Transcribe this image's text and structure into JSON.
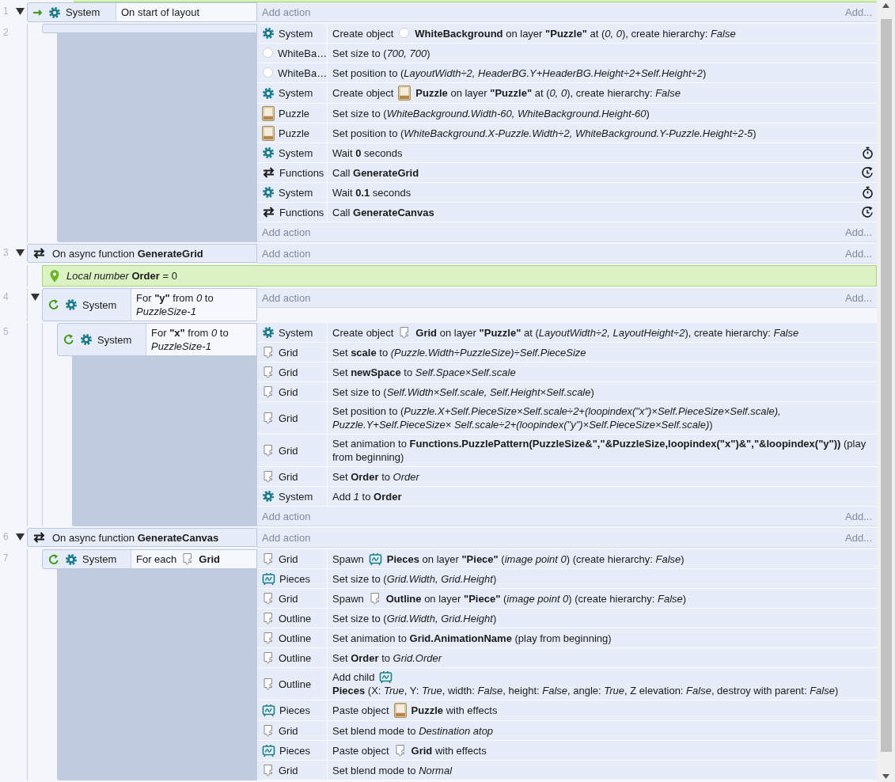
{
  "events": [
    {
      "kind": "trigger",
      "number": "1",
      "expanded": true,
      "object": {
        "kind": "system",
        "name": "System"
      },
      "parts": [
        {
          "kind": "text",
          "text": "On start of layout"
        }
      ],
      "add_action": "Add action",
      "add": "Add...",
      "children": [
        {
          "kind": "block",
          "number": "2",
          "add_action": "Add action",
          "add": "Add...",
          "actions": [
            {
              "object": {
                "kind": "system",
                "name": "System"
              },
              "parts": [
                {
                  "kind": "text",
                  "text": "Create object"
                },
                {
                  "kind": "round-sprite"
                },
                {
                  "kind": "text",
                  "text": "**WhiteBackground** on layer **\"Puzzle\"** at (*0, 0*), create hierarchy: *False*"
                }
              ]
            },
            {
              "object": {
                "kind": "round-sprite",
                "name": "WhiteBa…"
              },
              "parts": [
                {
                  "kind": "text",
                  "text": "Set size to (*700, 700*)"
                }
              ]
            },
            {
              "object": {
                "kind": "round-sprite",
                "name": "WhiteBa…"
              },
              "parts": [
                {
                  "kind": "text",
                  "text": "Set position to (*LayoutWidth÷2, HeaderBG.Y+HeaderBG.Height÷2+Self.Height÷2*)"
                }
              ]
            },
            {
              "object": {
                "kind": "system",
                "name": "System"
              },
              "parts": [
                {
                  "kind": "text",
                  "text": "Create object"
                },
                {
                  "kind": "image-sprite"
                },
                {
                  "kind": "text",
                  "text": "**Puzzle** on layer **\"Puzzle\"** at (*0, 0*), create hierarchy: *False*"
                }
              ]
            },
            {
              "object": {
                "kind": "image-sprite",
                "name": "Puzzle"
              },
              "parts": [
                {
                  "kind": "text",
                  "text": "Set size to (*WhiteBackground.Width-60, WhiteBackground.Height-60*)"
                }
              ]
            },
            {
              "object": {
                "kind": "image-sprite",
                "name": "Puzzle"
              },
              "parts": [
                {
                  "kind": "text",
                  "text": "Set position to (*WhiteBackground.X-Puzzle.Width÷2, WhiteBackground.Y-Puzzle.Height÷2-5*)"
                }
              ]
            },
            {
              "object": {
                "kind": "system",
                "name": "System"
              },
              "parts": [
                {
                  "kind": "text",
                  "text": "Wait **0** seconds"
                }
              ],
              "suffix": {
                "kind": "wait"
              }
            },
            {
              "object": {
                "kind": "function",
                "name": "Functions"
              },
              "parts": [
                {
                  "kind": "text",
                  "text": "Call **GenerateGrid**"
                }
              ],
              "suffix": {
                "kind": "await"
              }
            },
            {
              "object": {
                "kind": "system",
                "name": "System"
              },
              "parts": [
                {
                  "kind": "text",
                  "text": "Wait **0.1** seconds"
                }
              ],
              "suffix": {
                "kind": "wait"
              }
            },
            {
              "object": {
                "kind": "function",
                "name": "Functions"
              },
              "parts": [
                {
                  "kind": "text",
                  "text": "Call **GenerateCanvas**"
                }
              ],
              "suffix": {
                "kind": "await"
              }
            }
          ]
        }
      ]
    },
    {
      "kind": "function",
      "number": "3",
      "expanded": true,
      "parts": [
        {
          "kind": "text",
          "text": "On async function **GenerateGrid**"
        }
      ],
      "add_action": "Add action",
      "add": "Add...",
      "children": [
        {
          "kind": "variable",
          "text": "*Local number* **Order** = 0"
        },
        {
          "kind": "loop",
          "number": "4",
          "expanded": true,
          "object": {
            "kind": "system",
            "name": "System"
          },
          "parts": [
            {
              "kind": "text",
              "text": "For **\"y\"** from *0* to *PuzzleSize-1*"
            }
          ],
          "add_action": "Add action",
          "add": "Add...",
          "children": [
            {
              "kind": "loop",
              "number": "5",
              "object": {
                "kind": "system",
                "name": "System"
              },
              "parts": [
                {
                  "kind": "text",
                  "text": "For **\"x\"** from *0* to *PuzzleSize-1*"
                }
              ],
              "add_action": "Add action",
              "add": "Add...",
              "actions": [
                {
                  "object": {
                    "kind": "system",
                    "name": "System"
                  },
                  "parts": [
                    {
                      "kind": "text",
                      "text": "Create object"
                    },
                    {
                      "kind": "outline-sprite"
                    },
                    {
                      "kind": "text",
                      "text": "**Grid** on layer **\"Puzzle\"** at (*LayoutWidth÷2, LayoutHeight÷2*), create hierarchy: *False*"
                    }
                  ]
                },
                {
                  "object": {
                    "kind": "outline-sprite",
                    "name": "Grid"
                  },
                  "parts": [
                    {
                      "kind": "text",
                      "text": "Set **scale** to *(Puzzle.Width÷PuzzleSize)÷Self.PieceSize*"
                    }
                  ]
                },
                {
                  "object": {
                    "kind": "outline-sprite",
                    "name": "Grid"
                  },
                  "parts": [
                    {
                      "kind": "text",
                      "text": "Set **newSpace** to *Self.Space×Self.scale*"
                    }
                  ]
                },
                {
                  "object": {
                    "kind": "outline-sprite",
                    "name": "Grid"
                  },
                  "parts": [
                    {
                      "kind": "text",
                      "text": "Set size to (*Self.Width×Self.scale, Self.Height×Self.scale*)"
                    }
                  ]
                },
                {
                  "object": {
                    "kind": "outline-sprite",
                    "name": "Grid"
                  },
                  "parts": [
                    {
                      "kind": "text",
                      "text": "Set position to (*Puzzle.X+Self.PieceSize×Self.scale÷2+(loopindex(\"x\")×Self.PieceSize×Self.scale), Puzzle.Y+Self.PieceSize× Self.scale÷2+(loopindex(\"y\")×Self.PieceSize×Self.scale)*)"
                    }
                  ]
                },
                {
                  "object": {
                    "kind": "outline-sprite",
                    "name": "Grid"
                  },
                  "parts": [
                    {
                      "kind": "text",
                      "text": "Set animation to **Functions.PuzzlePattern(PuzzleSize&\",\"&PuzzleSize,loopindex(\"x\")&\",\"&loopindex(\"y\"))** (play from beginning)"
                    }
                  ]
                },
                {
                  "object": {
                    "kind": "outline-sprite",
                    "name": "Grid"
                  },
                  "parts": [
                    {
                      "kind": "text",
                      "text": "Set **Order** to *Order*"
                    }
                  ]
                },
                {
                  "object": {
                    "kind": "system",
                    "name": "System"
                  },
                  "parts": [
                    {
                      "kind": "text",
                      "text": "Add *1* to **Order**"
                    }
                  ]
                }
              ]
            }
          ]
        }
      ]
    },
    {
      "kind": "function",
      "number": "6",
      "expanded": true,
      "parts": [
        {
          "kind": "text",
          "text": "On async function **GenerateCanvas**"
        }
      ],
      "add_action": "Add action",
      "add": "Add...",
      "children": [
        {
          "kind": "loop",
          "number": "7",
          "object": {
            "kind": "system",
            "name": "System"
          },
          "parts": [
            {
              "kind": "text",
              "text": "For each"
            },
            {
              "kind": "outline-sprite"
            },
            {
              "kind": "text",
              "text": "**Grid**"
            }
          ],
          "actions": [
            {
              "object": {
                "kind": "outline-sprite",
                "name": "Grid"
              },
              "parts": [
                {
                  "kind": "text",
                  "text": "Spawn"
                },
                {
                  "kind": "drawing-canvas"
                },
                {
                  "kind": "text",
                  "text": "**Pieces** on layer **\"Piece\"** (*image point 0*) (create hierarchy: *False*)"
                }
              ]
            },
            {
              "object": {
                "kind": "drawing-canvas",
                "name": "Pieces"
              },
              "parts": [
                {
                  "kind": "text",
                  "text": "Set size to (*Grid.Width, Grid.Height*)"
                }
              ]
            },
            {
              "object": {
                "kind": "outline-sprite",
                "name": "Grid"
              },
              "parts": [
                {
                  "kind": "text",
                  "text": "Spawn"
                },
                {
                  "kind": "outline-sprite"
                },
                {
                  "kind": "text",
                  "text": "**Outline** on layer **\"Piece\"** (*image point 0*) (create hierarchy: *False*)"
                }
              ]
            },
            {
              "object": {
                "kind": "outline-sprite",
                "name": "Outline"
              },
              "parts": [
                {
                  "kind": "text",
                  "text": "Set size to (*Grid.Width, Grid.Height*)"
                }
              ]
            },
            {
              "object": {
                "kind": "outline-sprite",
                "name": "Outline"
              },
              "parts": [
                {
                  "kind": "text",
                  "text": "Set animation to **Grid.AnimationName** (play from beginning)"
                }
              ]
            },
            {
              "object": {
                "kind": "outline-sprite",
                "name": "Outline"
              },
              "parts": [
                {
                  "kind": "text",
                  "text": "Set **Order** to *Grid.Order*"
                }
              ]
            },
            {
              "object": {
                "kind": "outline-sprite",
                "name": "Outline"
              },
              "parts": [
                {
                  "kind": "text",
                  "text": "Add child"
                },
                {
                  "kind": "drawing-canvas"
                },
                {
                  "kind": "text",
                  "text": "**Pieces** (X: *True*, Y: *True*, width: *False*, height: *False*, angle: *True*, Z elevation: *False*, destroy with parent: *False*)"
                }
              ]
            },
            {
              "object": {
                "kind": "drawing-canvas",
                "name": "Pieces"
              },
              "parts": [
                {
                  "kind": "text",
                  "text": "Paste object"
                },
                {
                  "kind": "image-sprite"
                },
                {
                  "kind": "text",
                  "text": "**Puzzle** with effects"
                }
              ]
            },
            {
              "object": {
                "kind": "outline-sprite",
                "name": "Grid"
              },
              "parts": [
                {
                  "kind": "text",
                  "text": "Set blend mode to *Destination atop*"
                }
              ]
            },
            {
              "object": {
                "kind": "drawing-canvas",
                "name": "Pieces"
              },
              "parts": [
                {
                  "kind": "text",
                  "text": "Paste object"
                },
                {
                  "kind": "outline-sprite"
                },
                {
                  "kind": "text",
                  "text": "**Grid** with effects"
                }
              ]
            },
            {
              "object": {
                "kind": "outline-sprite",
                "name": "Grid"
              },
              "parts": [
                {
                  "kind": "text",
                  "text": "Set blend mode to *Normal*"
                }
              ]
            }
          ]
        }
      ]
    }
  ]
}
